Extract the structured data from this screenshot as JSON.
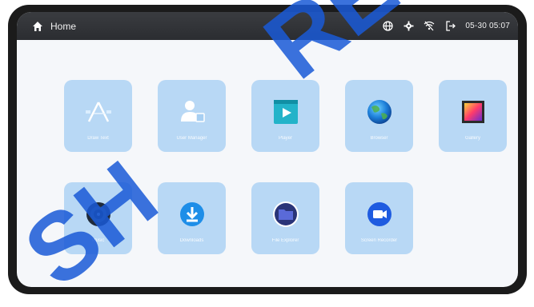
{
  "header": {
    "title": "Home",
    "time": "05-30 05:07"
  },
  "status_icons": [
    "globe-icon",
    "gear-icon",
    "wifi-off-icon",
    "logout-icon"
  ],
  "apps": [
    {
      "label": "Draw Text",
      "icon": "draw-text-icon"
    },
    {
      "label": "User Manager",
      "icon": "user-manager-icon"
    },
    {
      "label": "Player",
      "icon": "player-icon"
    },
    {
      "label": "Browser",
      "icon": "browser-icon"
    },
    {
      "label": "Gallery",
      "icon": "gallery-icon"
    },
    {
      "label": "Music",
      "icon": "music-icon"
    },
    {
      "label": "Downloads",
      "icon": "downloads-icon"
    },
    {
      "label": "File Explorer",
      "icon": "file-explorer-icon"
    },
    {
      "label": "Screen Recorder",
      "icon": "screen-recorder-icon"
    }
  ],
  "colors": {
    "tile": "#b8d8f5",
    "accent": "#1a5ad7",
    "statusbar": "#2f3135"
  },
  "watermark": {
    "text_top": "RE",
    "text_bottom": "SH"
  }
}
